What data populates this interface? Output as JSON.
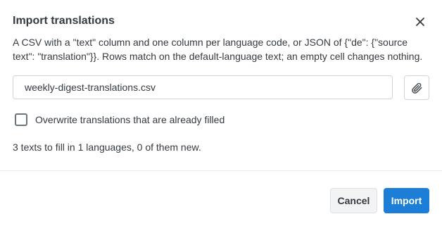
{
  "dialog": {
    "title": "Import translations",
    "close_icon": "close-icon",
    "description": "A CSV with a \"text\" column and one column per language code, or JSON of {\"de\": {\"source text\": \"translation\"}}. Rows match on the default-language text; an empty cell changes nothing.",
    "file_input": {
      "value": "weekly-digest-translations.csv"
    },
    "attach_icon": "paperclip-icon",
    "overwrite": {
      "label": "Overwrite translations that are already filled",
      "checked": false
    },
    "summary": "3 texts to fill in 1 languages, 0 of them new.",
    "cancel_label": "Cancel",
    "import_label": "Import",
    "colors": {
      "primary": "#1c7ed6",
      "secondary_bg": "#f1f3f5",
      "border": "#ced4da",
      "text": "#343a40"
    }
  }
}
